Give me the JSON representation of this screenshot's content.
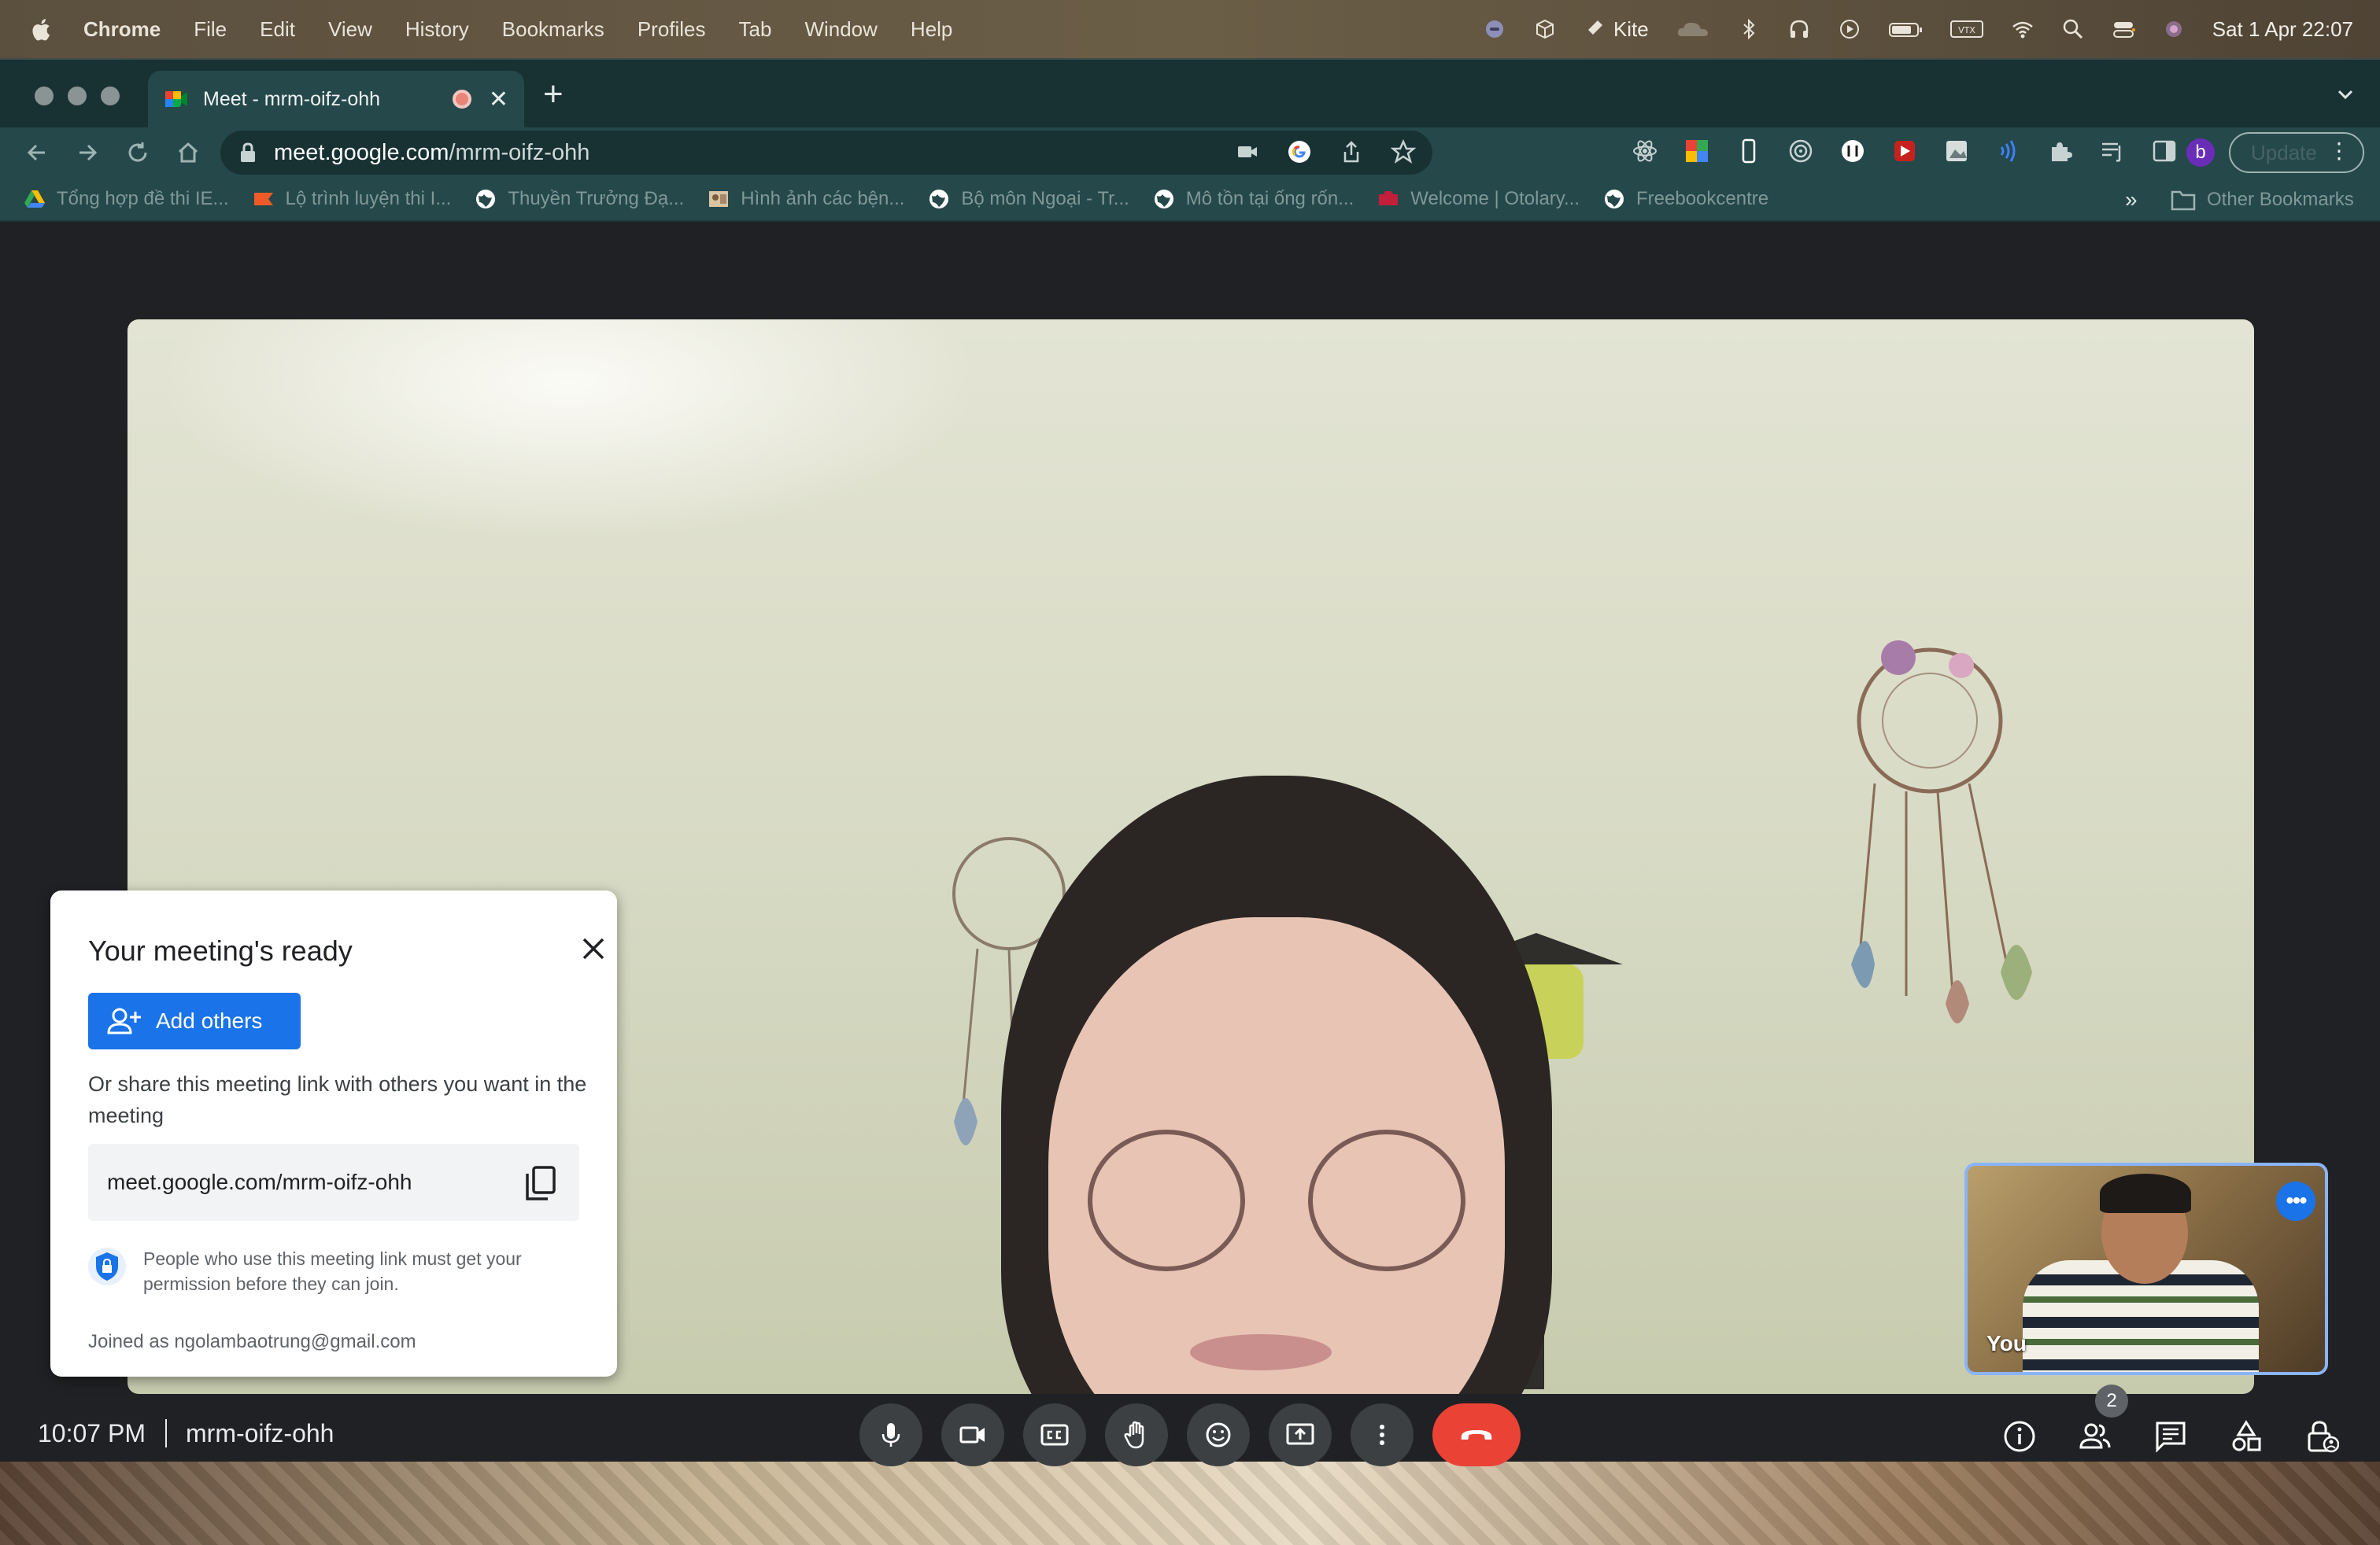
{
  "menubar": {
    "app_name": "Chrome",
    "items": [
      "File",
      "Edit",
      "View",
      "History",
      "Bookmarks",
      "Profiles",
      "Tab",
      "Window",
      "Help"
    ],
    "tray_kite": "Kite",
    "clock": "Sat 1 Apr  22:07"
  },
  "browser": {
    "tab_title": "Meet - mrm-oifz-ohh",
    "url_host": "meet.google.com",
    "url_path": "/mrm-oifz-ohh",
    "profile_initial": "b",
    "update_label": "Update",
    "bookmarks": [
      "Tổng hợp đề thi IE...",
      "Lộ trình luyện thi I...",
      "Thuyền Trưởng Đạ...",
      "Hình ảnh các bện...",
      "Bộ môn Ngoại - Tr...",
      "Mô tồn tại ống rốn...",
      "Welcome | Otolary...",
      "Freebookcentre"
    ],
    "bookmarks_more": "»",
    "other_bookmarks": "Other Bookmarks"
  },
  "meet": {
    "self_label": "You",
    "ready_card": {
      "title": "Your meeting's ready",
      "add_others": "Add others",
      "share_text": "Or share this meeting link with others you want in the meeting",
      "link": "meet.google.com/mrm-oifz-ohh",
      "permission_text": "People who use this meeting link must get your permission before they can join.",
      "joined_as": "Joined as ngolambaotrung@gmail.com"
    },
    "bottom_bar": {
      "time": "10:07 PM",
      "meeting_code": "mrm-oifz-ohh",
      "participants_count": "2"
    }
  },
  "colors": {
    "meet_background": "#202124",
    "control_button": "#3c4043",
    "end_call": "#ea4335",
    "primary_blue": "#1a73e8",
    "selfview_border": "#8ab4f8"
  }
}
